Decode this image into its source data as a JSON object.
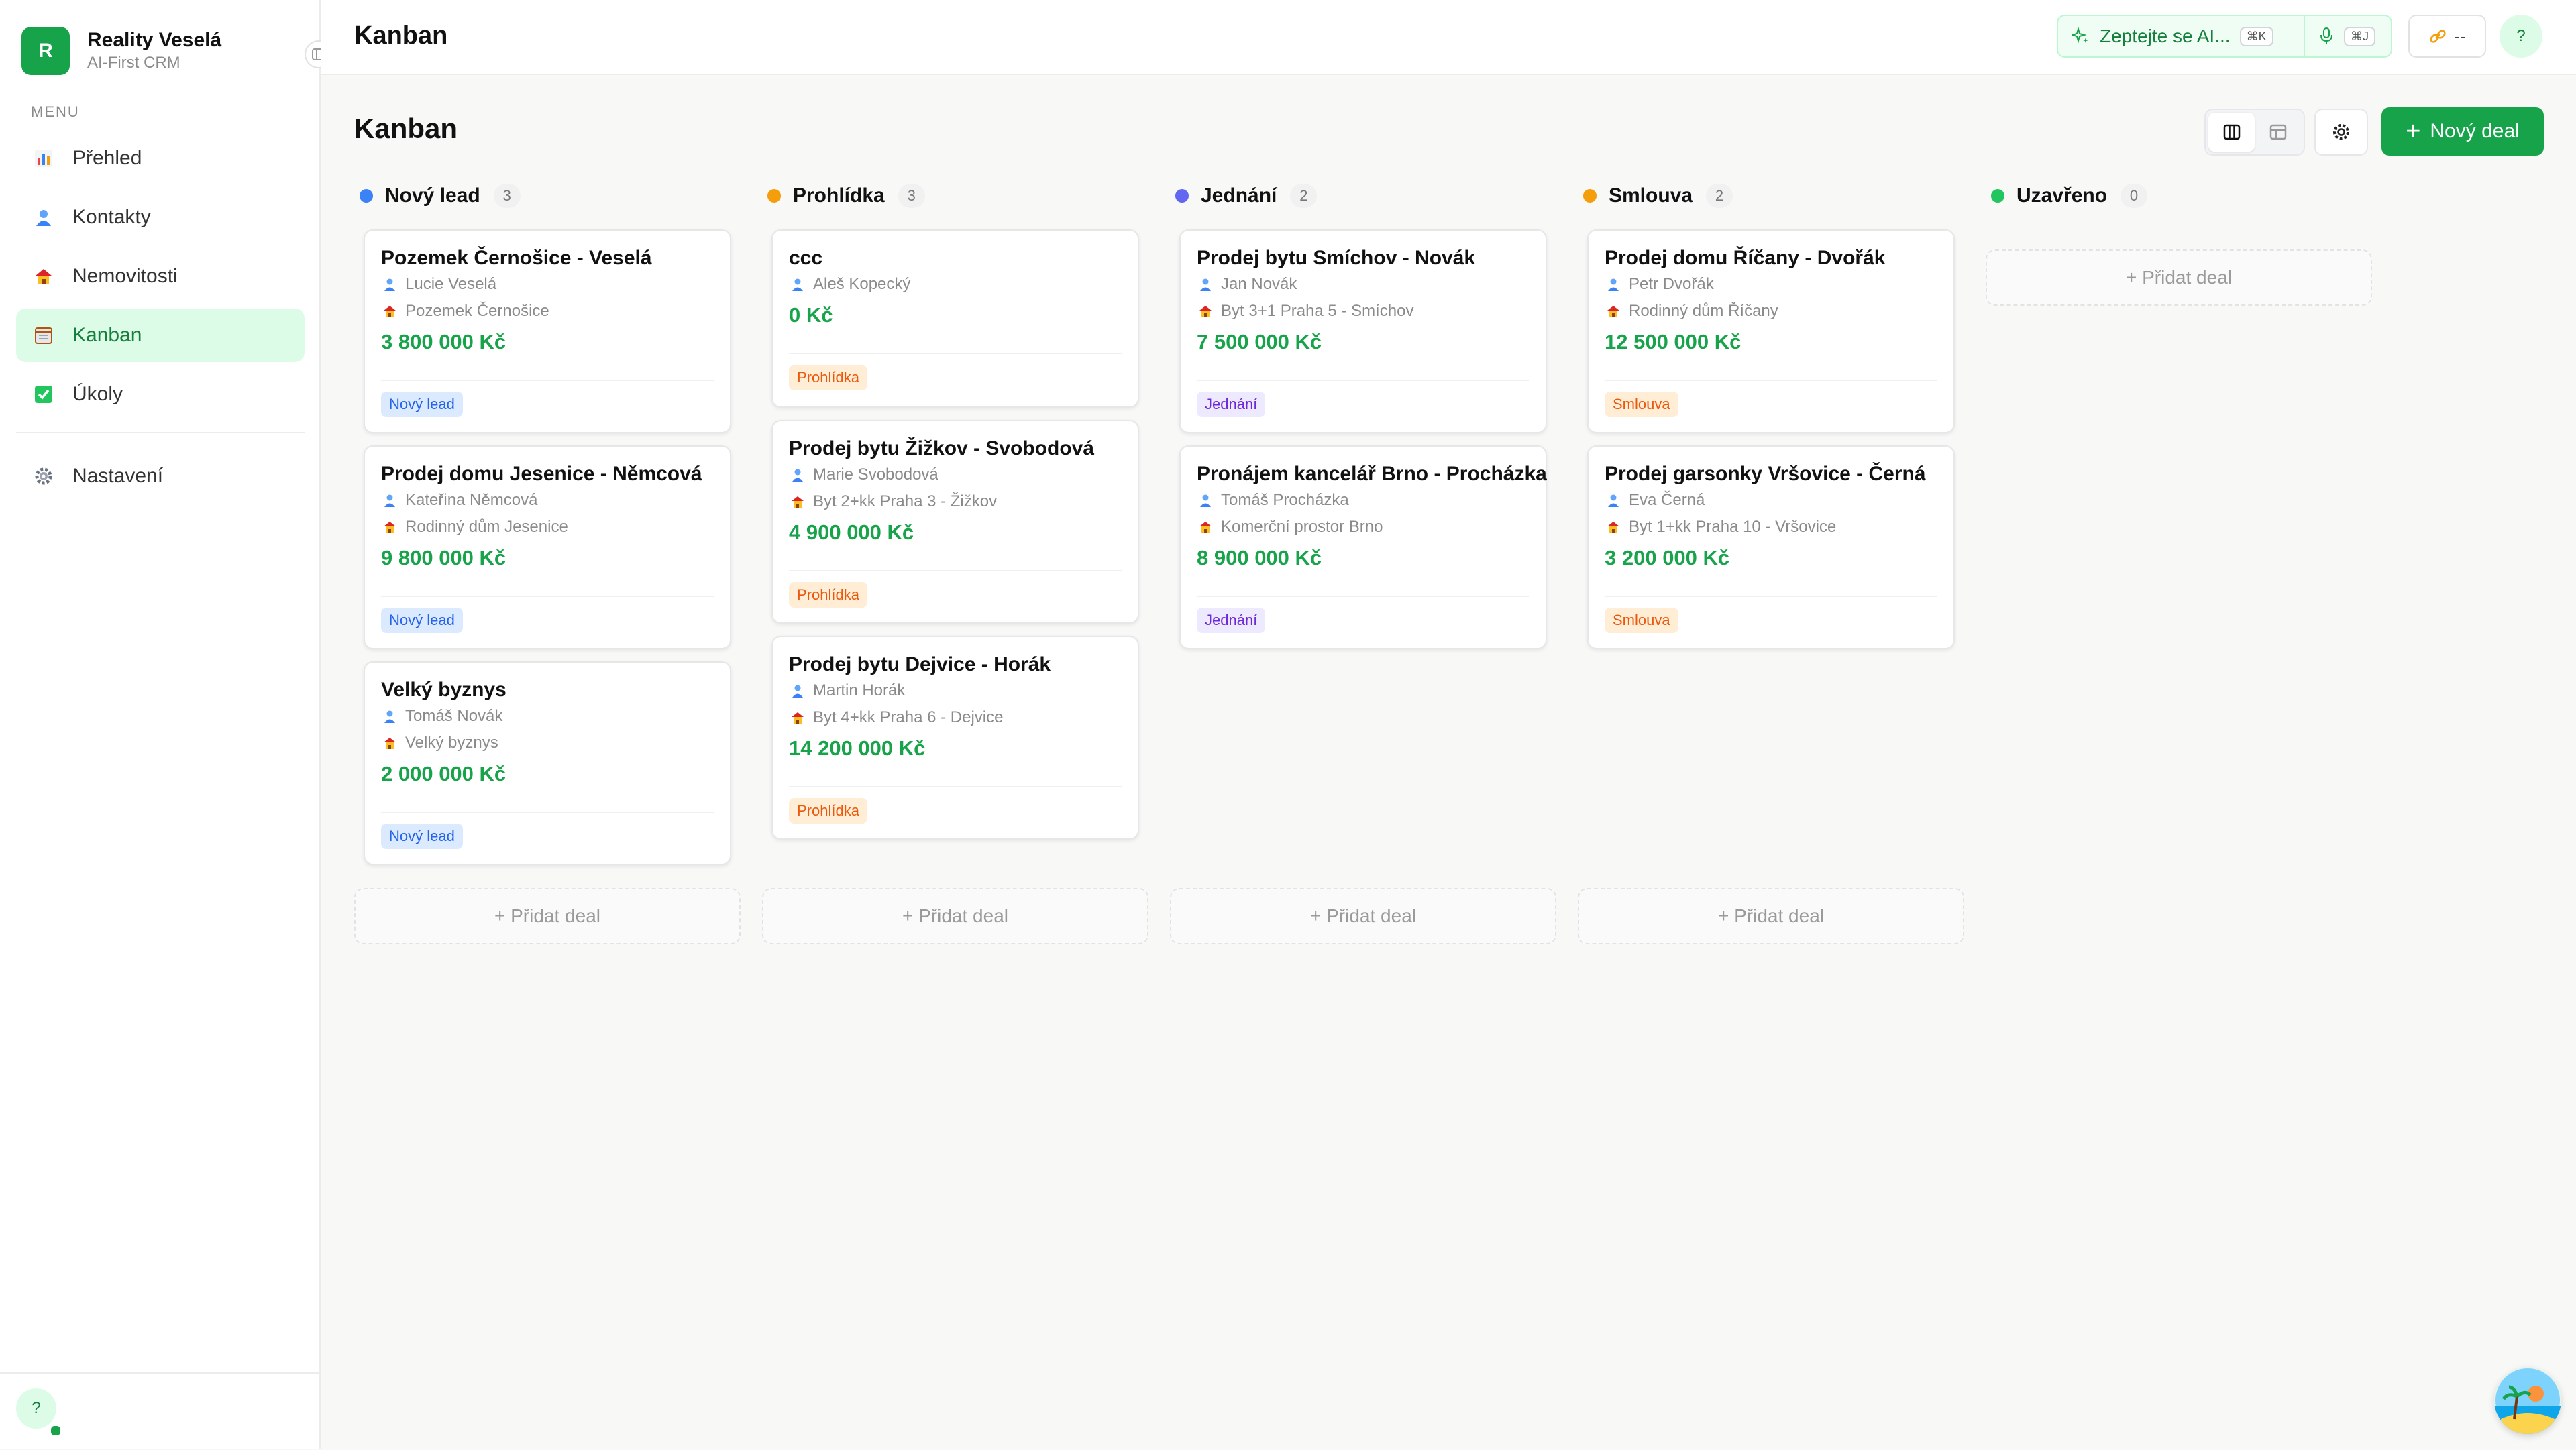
{
  "brand": {
    "initial": "R",
    "name": "Reality Veselá",
    "subtitle": "AI-First CRM"
  },
  "sidebar": {
    "menu_heading": "MENU",
    "items": [
      {
        "label": "Přehled",
        "icon": "bar-chart-icon"
      },
      {
        "label": "Kontakty",
        "icon": "person-icon"
      },
      {
        "label": "Nemovitosti",
        "icon": "house-icon"
      },
      {
        "label": "Kanban",
        "icon": "calendar-board-icon",
        "active": true
      },
      {
        "label": "Úkoly",
        "icon": "checkbox-icon"
      },
      {
        "label": "Nastavení",
        "icon": "gear-icon"
      }
    ],
    "help": "?"
  },
  "topbar": {
    "title": "Kanban",
    "ai_ask": "Zeptejte se AI...",
    "ai_shortcut": "⌘K",
    "mic_shortcut": "⌘J",
    "link_status": "--",
    "help": "?"
  },
  "main": {
    "title": "Kanban",
    "new_deal": "Nový deal",
    "add_deal": "+ Přidat deal"
  },
  "colors": {
    "accent": "#16a34a",
    "lead": "#3b82f6",
    "viewing": "#f59e0b",
    "negotiation": "#6366f1",
    "contract": "#f59e0b",
    "closed": "#22c55e"
  },
  "columns": [
    {
      "title": "Nový lead",
      "count": "3",
      "color": "#3b82f6",
      "cards": [
        {
          "title": "Pozemek Černošice - Veselá",
          "contact": "Lucie Veselá",
          "property": "Pozemek Černošice",
          "value": "3 800 000 Kč",
          "badge": "Nový lead"
        },
        {
          "title": "Prodej domu Jesenice - Němcová",
          "contact": "Kateřina Němcová",
          "property": "Rodinný dům Jesenice",
          "value": "9 800 000 Kč",
          "badge": "Nový lead"
        },
        {
          "title": "Velký byznys",
          "contact": "Tomáš Novák",
          "property": "Velký byznys",
          "value": "2 000 000 Kč",
          "badge": "Nový lead"
        }
      ]
    },
    {
      "title": "Prohlídka",
      "count": "3",
      "color": "#f59e0b",
      "cards": [
        {
          "title": "ccc",
          "contact": "Aleš Kopecký",
          "property": "",
          "value": "0 Kč",
          "badge": "Prohlídka"
        },
        {
          "title": "Prodej bytu Žižkov - Svobodová",
          "contact": "Marie Svobodová",
          "property": "Byt 2+kk Praha 3 - Žižkov",
          "value": "4 900 000 Kč",
          "badge": "Prohlídka"
        },
        {
          "title": "Prodej bytu Dejvice - Horák",
          "contact": "Martin Horák",
          "property": "Byt 4+kk Praha 6 - Dejvice",
          "value": "14 200 000 Kč",
          "badge": "Prohlídka"
        }
      ]
    },
    {
      "title": "Jednání",
      "count": "2",
      "color": "#6366f1",
      "cards": [
        {
          "title": "Prodej bytu Smíchov - Novák",
          "contact": "Jan Novák",
          "property": "Byt 3+1 Praha 5 - Smíchov",
          "value": "7 500 000 Kč",
          "badge": "Jednání"
        },
        {
          "title": "Pronájem kancelář Brno - Procházka",
          "contact": "Tomáš Procházka",
          "property": "Komerční prostor Brno",
          "value": "8 900 000 Kč",
          "badge": "Jednání"
        }
      ]
    },
    {
      "title": "Smlouva",
      "count": "2",
      "color": "#f59e0b",
      "cards": [
        {
          "title": "Prodej domu Říčany - Dvořák",
          "contact": "Petr Dvořák",
          "property": "Rodinný dům Říčany",
          "value": "12 500 000 Kč",
          "badge": "Smlouva"
        },
        {
          "title": "Prodej garsonky Vršovice - Černá",
          "contact": "Eva Černá",
          "property": "Byt 1+kk Praha 10 - Vršovice",
          "value": "3 200 000 Kč",
          "badge": "Smlouva"
        }
      ]
    },
    {
      "title": "Uzavřeno",
      "count": "0",
      "color": "#22c55e",
      "cards": []
    }
  ]
}
